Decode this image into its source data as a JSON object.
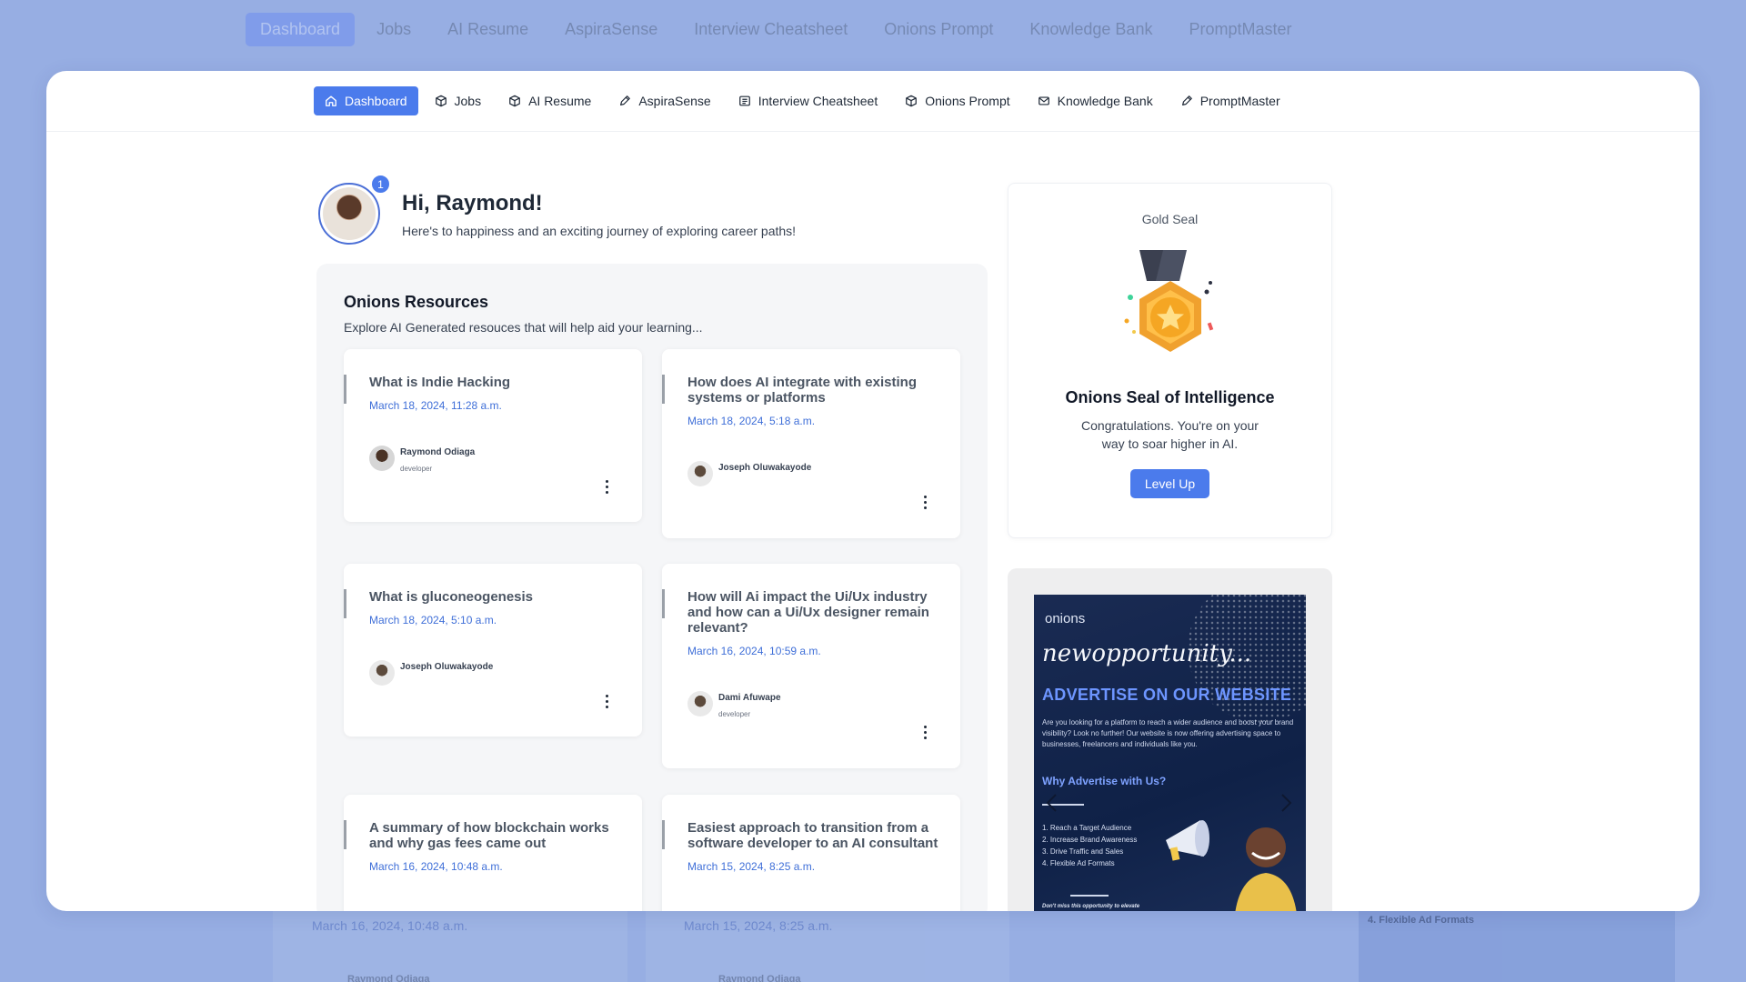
{
  "nav": {
    "items": [
      {
        "label": "Dashboard",
        "icon": "home-icon",
        "active": true
      },
      {
        "label": "Jobs",
        "icon": "cube-icon",
        "active": false
      },
      {
        "label": "AI Resume",
        "icon": "cube-icon",
        "active": false
      },
      {
        "label": "AspiraSense",
        "icon": "pen-icon",
        "active": false
      },
      {
        "label": "Interview Cheatsheet",
        "icon": "list-icon",
        "active": false
      },
      {
        "label": "Onions Prompt",
        "icon": "cube-icon",
        "active": false
      },
      {
        "label": "Knowledge Bank",
        "icon": "mail-icon",
        "active": false
      },
      {
        "label": "PromptMaster",
        "icon": "pen-icon",
        "active": false
      }
    ]
  },
  "greeting": {
    "title": "Hi, Raymond!",
    "subtitle": "Here's to happiness and an exciting journey of exploring career paths!",
    "notification_count": "1"
  },
  "resources": {
    "title": "Onions Resources",
    "subtitle": "Explore AI Generated resouces that will help aid your learning...",
    "cards": [
      {
        "title": "What is Indie Hacking",
        "date": "March 18, 2024, 11:28 a.m.",
        "author": "Raymond Odiaga",
        "role": "developer"
      },
      {
        "title": "How does AI integrate with existing systems or platforms",
        "date": "March 18, 2024, 5:18 a.m.",
        "author": "Joseph Oluwakayode",
        "role": ""
      },
      {
        "title": "What is gluconeogenesis",
        "date": "March 18, 2024, 5:10 a.m.",
        "author": "Joseph Oluwakayode",
        "role": ""
      },
      {
        "title": "How will Ai impact the Ui/Ux industry and how can a Ui/Ux designer remain relevant?",
        "date": "March 16, 2024, 10:59 a.m.",
        "author": "Dami Afuwape",
        "role": "developer"
      },
      {
        "title": "A summary of how blockchain works and why gas fees came out",
        "date": "March 16, 2024, 10:48 a.m.",
        "author": "",
        "role": ""
      },
      {
        "title": "Easiest approach to transition from a software developer to an AI consultant",
        "date": "March 15, 2024, 8:25 a.m.",
        "author": "",
        "role": ""
      }
    ]
  },
  "seal": {
    "label": "Gold Seal",
    "title": "Onions Seal of Intelligence",
    "text": "Congratulations. You're on your way to soar higher in AI.",
    "button": "Level Up"
  },
  "ad": {
    "logo": "onions",
    "headline": "newopportunity...",
    "subheadline": "ADVERTISE ON OUR WEBSITE",
    "body": "Are you looking for a platform to reach a wider audience and boost your brand visibility? Look no further! Our website is now offering advertising space to businesses, freelancers and individuals like you.",
    "why": "Why Advertise with Us?",
    "list": [
      "1. Reach a Target Audience",
      "2. Increase Brand Awareness",
      "3. Drive Traffic and Sales",
      "4. Flexible Ad Formats"
    ],
    "footer": "Don't miss this opportunity to elevate"
  },
  "background": {
    "date_left": "March 16, 2024, 10:48 a.m.",
    "date_right": "March 15, 2024, 8:25 a.m.",
    "author_left": "Raymond Odiaga",
    "author_right": "Raymond Odiaga",
    "ad_item": "4. Flexible Ad Formats"
  },
  "colors": {
    "accent": "#4b7bec",
    "date": "#3f6fd8",
    "backdrop": "#97aee3"
  }
}
